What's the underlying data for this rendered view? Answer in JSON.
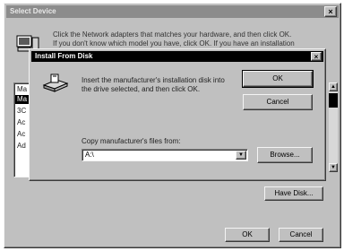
{
  "outer": {
    "title": "Select Device",
    "close_glyph": "×",
    "instruction_line1": "Click the Network adapters that matches your hardware, and then click OK.",
    "instruction_line2": "If you don't know which model you have, click OK. If you have an installation",
    "list_items": [
      "Ma",
      "Ma",
      "3C",
      "Ac",
      "Ac",
      "Ad"
    ],
    "buttons": {
      "have_disk": "Have Disk...",
      "ok": "OK",
      "cancel": "Cancel"
    }
  },
  "inner": {
    "title": "Install From Disk",
    "close_glyph": "×",
    "instruction": "Insert the manufacturer's installation disk into the drive selected, and then click OK.",
    "copy_label": "Copy manufacturer's files from:",
    "copy_value": "A:\\",
    "buttons": {
      "ok": "OK",
      "cancel": "Cancel",
      "browse": "Browse..."
    }
  },
  "icons": {
    "computer": "computer-icon",
    "disk_drive": "disk-drive-icon",
    "dropdown": "chevron-down-icon",
    "scroll_up": "arrow-up-icon",
    "scroll_down": "arrow-down-icon"
  }
}
